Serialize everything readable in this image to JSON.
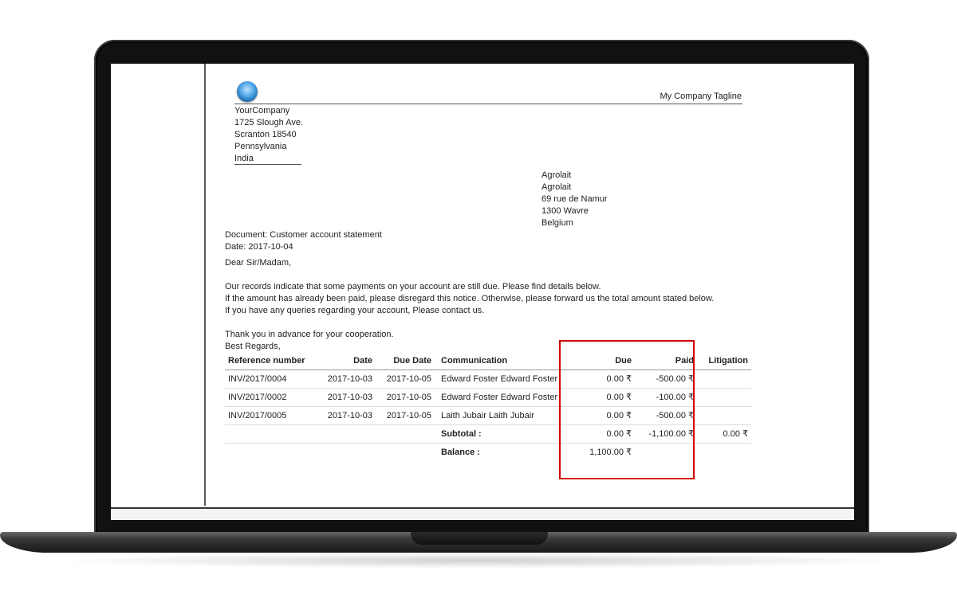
{
  "company": {
    "tagline": "My Company Tagline",
    "address_lines": [
      "YourCompany",
      "1725 Slough Ave.",
      "Scranton 18540",
      "Pennsylvania",
      "India"
    ]
  },
  "partner": {
    "address_lines": [
      "Agrolait",
      "Agrolait",
      "69 rue de Namur",
      "1300 Wavre",
      "Belgium"
    ]
  },
  "document": {
    "document_line": "Document: Customer account statement",
    "date_line": "Date: 2017-10-04",
    "greeting": "Dear Sir/Madam,",
    "body_lines": [
      "Our records indicate that some payments on your account are still due. Please find details below.",
      "If the amount has already been paid, please disregard this notice. Otherwise, please forward us the total amount stated below.",
      "If you have any queries regarding your account, Please contact us."
    ],
    "closing_lines": [
      "Thank you in advance for your cooperation.",
      "Best Regards,"
    ]
  },
  "table": {
    "headers": {
      "reference": "Reference number",
      "date": "Date",
      "due_date": "Due Date",
      "communication": "Communication",
      "due": "Due",
      "paid": "Paid",
      "litigation": "Litigation"
    },
    "rows": [
      {
        "reference": "INV/2017/0004",
        "date": "2017-10-03",
        "due_date": "2017-10-05",
        "communication": "Edward Foster Edward Foster",
        "due": "0.00 ₹",
        "paid": "-500.00 ₹",
        "litigation": ""
      },
      {
        "reference": "INV/2017/0002",
        "date": "2017-10-03",
        "due_date": "2017-10-05",
        "communication": "Edward Foster Edward Foster",
        "due": "0.00 ₹",
        "paid": "-100.00 ₹",
        "litigation": ""
      },
      {
        "reference": "INV/2017/0005",
        "date": "2017-10-03",
        "due_date": "2017-10-05",
        "communication": "Laith Jubair Laith Jubair",
        "due": "0.00 ₹",
        "paid": "-500.00 ₹",
        "litigation": ""
      }
    ],
    "subtotal": {
      "label": "Subtotal :",
      "due": "0.00 ₹",
      "paid": "-1,100.00 ₹",
      "litigation": "0.00 ₹"
    },
    "balance": {
      "label": "Balance :",
      "due": "1,100.00 ₹"
    }
  },
  "colors": {
    "highlight_box": "#d10000",
    "logo": "#4aa3e6"
  },
  "icons": {
    "logo": "company-logo-icon"
  }
}
